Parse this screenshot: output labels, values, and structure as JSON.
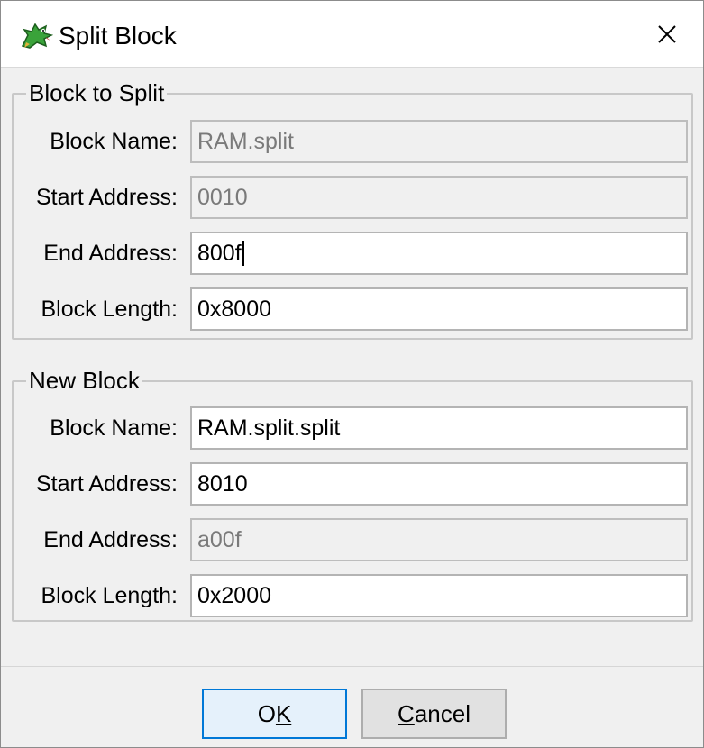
{
  "window": {
    "title": "Split Block",
    "icon": "dragon-icon",
    "close": "close-icon"
  },
  "block_to_split": {
    "legend": "Block to Split",
    "fields": [
      {
        "label": "Block Name:",
        "value": "RAM.split",
        "disabled": true
      },
      {
        "label": "Start Address:",
        "value": "0010",
        "disabled": true
      },
      {
        "label": "End Address:",
        "value": "800f",
        "disabled": false
      },
      {
        "label": "Block Length:",
        "value": "0x8000",
        "disabled": false
      }
    ]
  },
  "new_block": {
    "legend": "New Block",
    "fields": [
      {
        "label": "Block Name:",
        "value": "RAM.split.split",
        "disabled": false
      },
      {
        "label": "Start Address:",
        "value": "8010",
        "disabled": false
      },
      {
        "label": "End Address:",
        "value": "a00f",
        "disabled": true
      },
      {
        "label": "Block Length:",
        "value": "0x2000",
        "disabled": false
      }
    ]
  },
  "buttons": {
    "ok_prefix": "O",
    "ok_mnemonic": "K",
    "ok_suffix": "",
    "cancel_prefix": "",
    "cancel_mnemonic": "C",
    "cancel_suffix": "ancel"
  },
  "colors": {
    "focus_border": "#0078d7",
    "disabled_text": "#7a7a7a",
    "dialog_bg": "#f0f0f0"
  }
}
